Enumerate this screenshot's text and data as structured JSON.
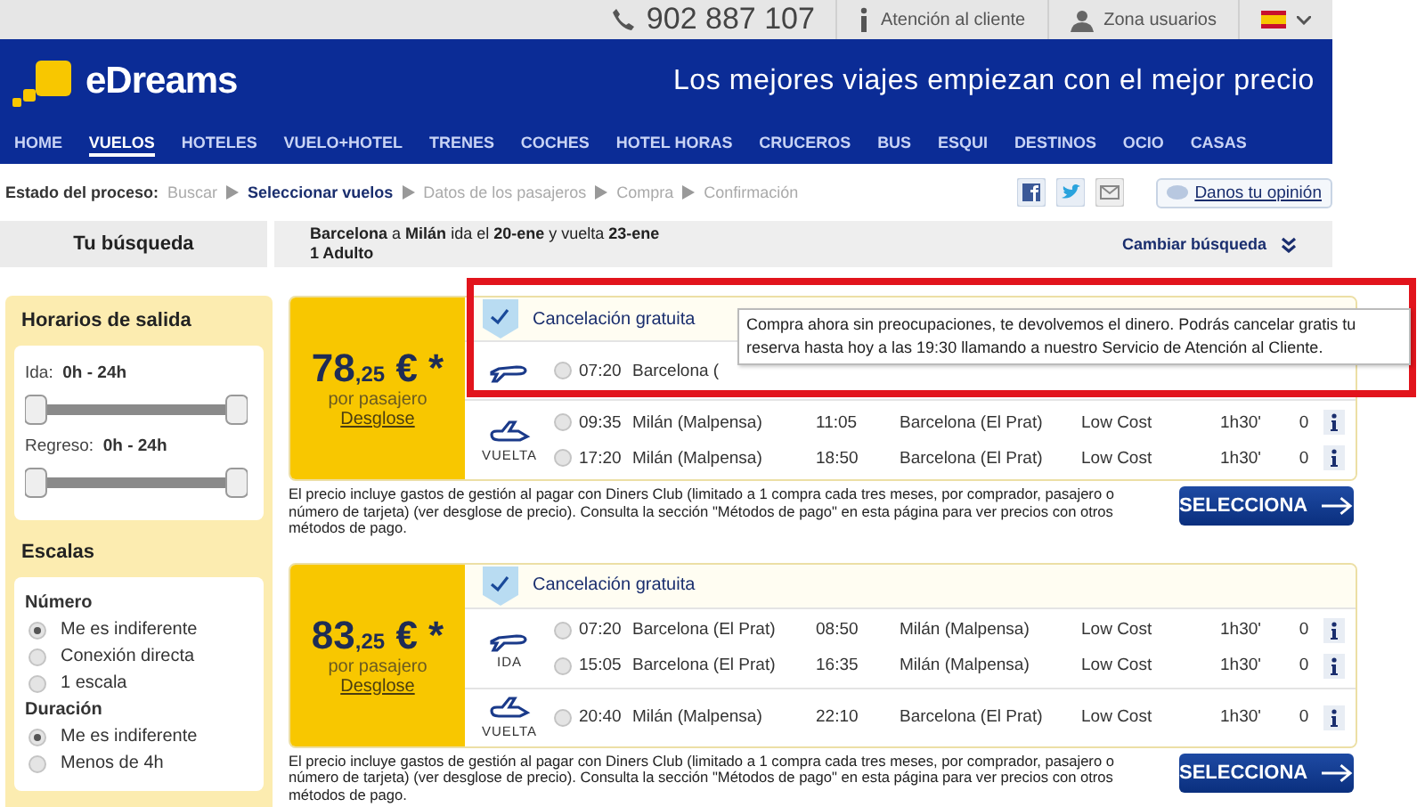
{
  "top_bar": {
    "phone": "902 887 107",
    "support": "Atención al cliente",
    "account": "Zona usuarios"
  },
  "header": {
    "logo": "eDreams",
    "tagline": "Los mejores viajes empiezan con el mejor precio"
  },
  "nav": [
    {
      "label": "HOME",
      "selected": false
    },
    {
      "label": "VUELOS",
      "selected": true
    },
    {
      "label": "HOTELES",
      "selected": false
    },
    {
      "label": "VUELO+HOTEL",
      "selected": false
    },
    {
      "label": "TRENES",
      "selected": false
    },
    {
      "label": "COCHES",
      "selected": false
    },
    {
      "label": "HOTEL HORAS",
      "selected": false
    },
    {
      "label": "CRUCEROS",
      "selected": false
    },
    {
      "label": "BUS",
      "selected": false
    },
    {
      "label": "ESQUI",
      "selected": false
    },
    {
      "label": "DESTINOS",
      "selected": false
    },
    {
      "label": "OCIO",
      "selected": false
    },
    {
      "label": "CASAS",
      "selected": false
    }
  ],
  "progress": {
    "label": "Estado del proceso:",
    "steps": [
      {
        "label": "Buscar",
        "selected": false
      },
      {
        "label": "Seleccionar vuelos",
        "selected": true
      },
      {
        "label": "Datos de los pasajeros",
        "selected": false
      },
      {
        "label": "Compra",
        "selected": false
      },
      {
        "label": "Confirmación",
        "selected": false
      }
    ]
  },
  "feedback": "Danos tu opinión",
  "search": {
    "title": "Tu búsqueda",
    "route": "**Barcelona** a **Milán** ida el **20-ene** y vuelta **23-ene**",
    "passengers": "1 Adulto",
    "change": "Cambiar búsqueda"
  },
  "filters": {
    "times": {
      "title": "Horarios de salida",
      "sliders": [
        {
          "label": "Ida:",
          "range": "0h - 24h",
          "level": 1
        },
        {
          "label": "Regreso:",
          "range": "0h - 24h",
          "level": 1
        }
      ]
    },
    "stops": {
      "title": "Escalas",
      "groups": [
        {
          "title": "Número",
          "options": [
            {
              "label": "Me es indiferente",
              "selected": true
            },
            {
              "label": "Conexión directa",
              "selected": false
            },
            {
              "label": "1 escala",
              "selected": false
            }
          ]
        },
        {
          "title": "Duración",
          "options": [
            {
              "label": "Me es indiferente",
              "selected": true
            },
            {
              "label": "Menos de 4h",
              "selected": false
            }
          ]
        }
      ]
    }
  },
  "results": [
    {
      "price": "78",
      "cents": ",25",
      "currency": "€ *",
      "per": "por pasajero",
      "breakdown": "Desglose",
      "cancellation": "Cancelación gratuita",
      "segments": [
        {
          "kind": "outbound",
          "rows": [
            {
              "selected": false,
              "time": "07:20",
              "origin": "Barcelona ("
            }
          ]
        },
        {
          "kind": "return",
          "label": "VUELTA",
          "rows": [
            {
              "selected": false,
              "time": "09:35",
              "origin": "Milán (Malpensa)",
              "arrival": "11:05",
              "destination": "Barcelona (El Prat)",
              "fare": "Low Cost",
              "duration": "1h30'",
              "stops": "0"
            },
            {
              "selected": false,
              "time": "17:20",
              "origin": "Milán (Malpensa)",
              "arrival": "18:50",
              "destination": "Barcelona (El Prat)",
              "fare": "Low Cost",
              "duration": "1h30'",
              "stops": "0"
            }
          ]
        }
      ],
      "note": "El precio incluye gastos de gestión al pagar con Diners Club (limitado a 1 compra cada tres meses, por comprador, pasajero o número de tarjeta) (ver desglose de precio). Consulta la sección \"Métodos de pago\" en esta página para ver precios con otros métodos de pago.",
      "button": "SELECCIONA"
    },
    {
      "price": "83",
      "cents": ",25",
      "currency": "€ *",
      "per": "por pasajero",
      "breakdown": "Desglose",
      "cancellation": "Cancelación gratuita",
      "segments": [
        {
          "kind": "outbound",
          "label": "IDA",
          "rows": [
            {
              "selected": false,
              "time": "07:20",
              "origin": "Barcelona (El Prat)",
              "arrival": "08:50",
              "destination": "Milán (Malpensa)",
              "fare": "Low Cost",
              "duration": "1h30'",
              "stops": "0"
            },
            {
              "selected": false,
              "time": "15:05",
              "origin": "Barcelona (El Prat)",
              "arrival": "16:35",
              "destination": "Milán (Malpensa)",
              "fare": "Low Cost",
              "duration": "1h30'",
              "stops": "0"
            }
          ]
        },
        {
          "kind": "return",
          "label": "VUELTA",
          "rows": [
            {
              "selected": false,
              "time": "20:40",
              "origin": "Milán (Malpensa)",
              "arrival": "22:10",
              "destination": "Barcelona (El Prat)",
              "fare": "Low Cost",
              "duration": "1h30'",
              "stops": "0"
            }
          ]
        }
      ],
      "note": "El precio incluye gastos de gestión al pagar con Diners Club (limitado a 1 compra cada tres meses, por comprador, pasajero o número de tarjeta) (ver desglose de precio). Consulta la sección \"Métodos de pago\" en esta página para ver precios con otros métodos de pago.",
      "button": "SELECCIONA"
    }
  ],
  "tooltip": "Compra ahora sin preocupaciones, te devolvemos el dinero. Podrás cancelar gratis tu reserva hasta hoy a las 19:30 llamando a nuestro Servicio de Atención al Cliente."
}
